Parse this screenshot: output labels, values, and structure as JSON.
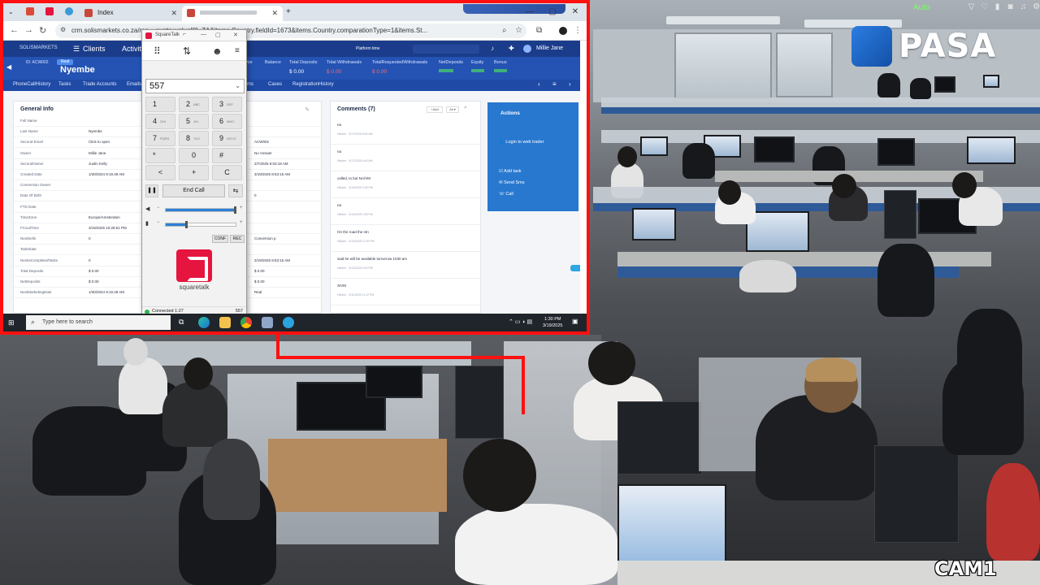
{
  "overlay": {
    "logo_text": "PASA",
    "cam_label": "CAM1",
    "cam_status": "Auto"
  },
  "browser": {
    "tabs": [
      {
        "label": "Index"
      },
      {
        "label": ""
      }
    ],
    "new_tab": "+",
    "url": "crm.solismarkets.co.za/mo...                                                           ountry.value[0]=ZA&items.Country.fieldId=1673&items.Country.comparationType=1&items.St..."
  },
  "crm": {
    "nav": {
      "clients": "Clients",
      "activity": "Activit",
      "platform_time": "Platform time",
      "search_placeholder": "",
      "user": "Millie Jane"
    },
    "header": {
      "name": "Nyembe",
      "stats": [
        {
          "label": "vos",
          "value": ""
        },
        {
          "label": "Balance",
          "value": "$ 0.00"
        },
        {
          "label": "Total Deposits",
          "value": "$ 0.00"
        },
        {
          "label": "Total Withdrawals",
          "value": ""
        },
        {
          "label": "TotalRequestedWithdrawals",
          "value": "$ 0.00"
        },
        {
          "label": "NetDeposits",
          "value": ""
        },
        {
          "label": "Equity",
          "value": ""
        },
        {
          "label": "Bonus",
          "value": ""
        }
      ]
    },
    "subnav": [
      "PhoneCallHistory",
      "Tasks",
      "Trade Accounts",
      "Emails",
      "ms",
      "Cases",
      "RegistrationHistory"
    ],
    "general_info": {
      "title": "General Info",
      "fields": [
        {
          "label": "Full Name",
          "value": ""
        },
        {
          "label": "Last Name",
          "value": "Nyembe"
        },
        {
          "label": "Second Email",
          "value": "Click to open"
        },
        {
          "label": "Owner",
          "value": "Millie Jane"
        },
        {
          "label": "SecondOwner",
          "value": "Justin Kelly"
        },
        {
          "label": "Created Date",
          "value": "1/30/2024 9:16:49 AM"
        },
        {
          "label": "Conversion Owner",
          "value": ""
        },
        {
          "label": "Date Of Birth",
          "value": ""
        },
        {
          "label": "FTD Date",
          "value": ""
        },
        {
          "label": "TimeZone",
          "value": "Europe/Amsterdam"
        },
        {
          "label": "FCsvdTime",
          "value": "3/19/2025 10:28:51 PM"
        },
        {
          "label": "NextSells",
          "value": "0"
        },
        {
          "label": "TaskState",
          "value": ""
        },
        {
          "label": "NextIsCompletedTasks",
          "value": "0"
        },
        {
          "label": "Total Deposits",
          "value": "$ 0.00"
        },
        {
          "label": "NetDeposits",
          "value": "$ 0.00"
        },
        {
          "label": "NextMarketingDate",
          "value": "1/30/2024 9:16:49 AM"
        }
      ]
    },
    "info_col2": [
      {
        "value": ""
      },
      {
        "value": ""
      },
      {
        "value": "ACW002"
      },
      {
        "value": "No Answer"
      },
      {
        "value": "2/7/2025 6:53:18 AM"
      },
      {
        "value": "3/19/2025 8:53:15 AM"
      },
      {
        "value": ""
      },
      {
        "value": "0"
      },
      {
        "value": ""
      },
      {
        "value": ""
      },
      {
        "value": ""
      },
      {
        "value": "Conversion p"
      },
      {
        "value": ""
      },
      {
        "value": "3/19/2025 8:53:15 AM"
      },
      {
        "value": "$ 0.00"
      },
      {
        "value": "$ 0.00"
      },
      {
        "value": "Real"
      }
    ],
    "comments": {
      "title": "Comments (7)",
      "add_label": "+Add",
      "items": [
        {
          "text": "na",
          "meta": "Hidden · 3/17/2025 6:59 AM"
        },
        {
          "text": "na",
          "meta": "Hidden · 3/17/2025 6:40 AM"
        },
        {
          "text": "called, to but NA/VM",
          "meta": "Hidden · 3/14/2025 3:25 PM"
        },
        {
          "text": "na",
          "meta": "Hidden · 3/14/2025 1:55 PM"
        },
        {
          "text": "On the road the ntn",
          "meta": "Hidden · 3/13/2025 12:39 PM"
        },
        {
          "text": "said he will be available tomorrow 1030 am",
          "meta": "Hidden · 3/12/2025 4:40 PM"
        },
        {
          "text": "SIVM",
          "meta": "Hidden · 3/11/2025 11:12 PM"
        }
      ]
    },
    "actions": {
      "title": "Actions",
      "items": [
        "Login to web trader",
        "Add task",
        "Send Sms",
        "Call"
      ]
    }
  },
  "dialer": {
    "title": "SquareTalk",
    "input_value": "557",
    "keys": [
      {
        "num": "1",
        "sub": ""
      },
      {
        "num": "2",
        "sub": "ABC"
      },
      {
        "num": "3",
        "sub": "DEF"
      },
      {
        "num": "4",
        "sub": "GHI"
      },
      {
        "num": "5",
        "sub": "JKL"
      },
      {
        "num": "6",
        "sub": "MNO"
      },
      {
        "num": "7",
        "sub": "PQRS"
      },
      {
        "num": "8",
        "sub": "TUV"
      },
      {
        "num": "9",
        "sub": "WXYZ"
      },
      {
        "num": "*",
        "sub": ""
      },
      {
        "num": "0",
        "sub": ""
      },
      {
        "num": "#",
        "sub": ""
      },
      {
        "num": "<",
        "sub": ""
      },
      {
        "num": "+",
        "sub": ""
      },
      {
        "num": "C",
        "sub": ""
      }
    ],
    "end_call_label": "End Call",
    "speaker_volume": 1.0,
    "mic_volume": 0.3,
    "conf_label": "CONF",
    "rec_label": "REC",
    "brand": "squaretalk",
    "status": "Connected 1:27",
    "extension": "557"
  },
  "taskbar": {
    "search_placeholder": "Type here to search",
    "time": "1:30 PM",
    "date": "3/19/2025"
  },
  "colors": {
    "highlight_border": "#ff1010",
    "crm_primary": "#1a3c8a",
    "actions_panel": "#2878d0",
    "squaretalk_brand": "#e5153f",
    "stat_red": "#ff6b6b",
    "stat_green": "#4cd964"
  }
}
